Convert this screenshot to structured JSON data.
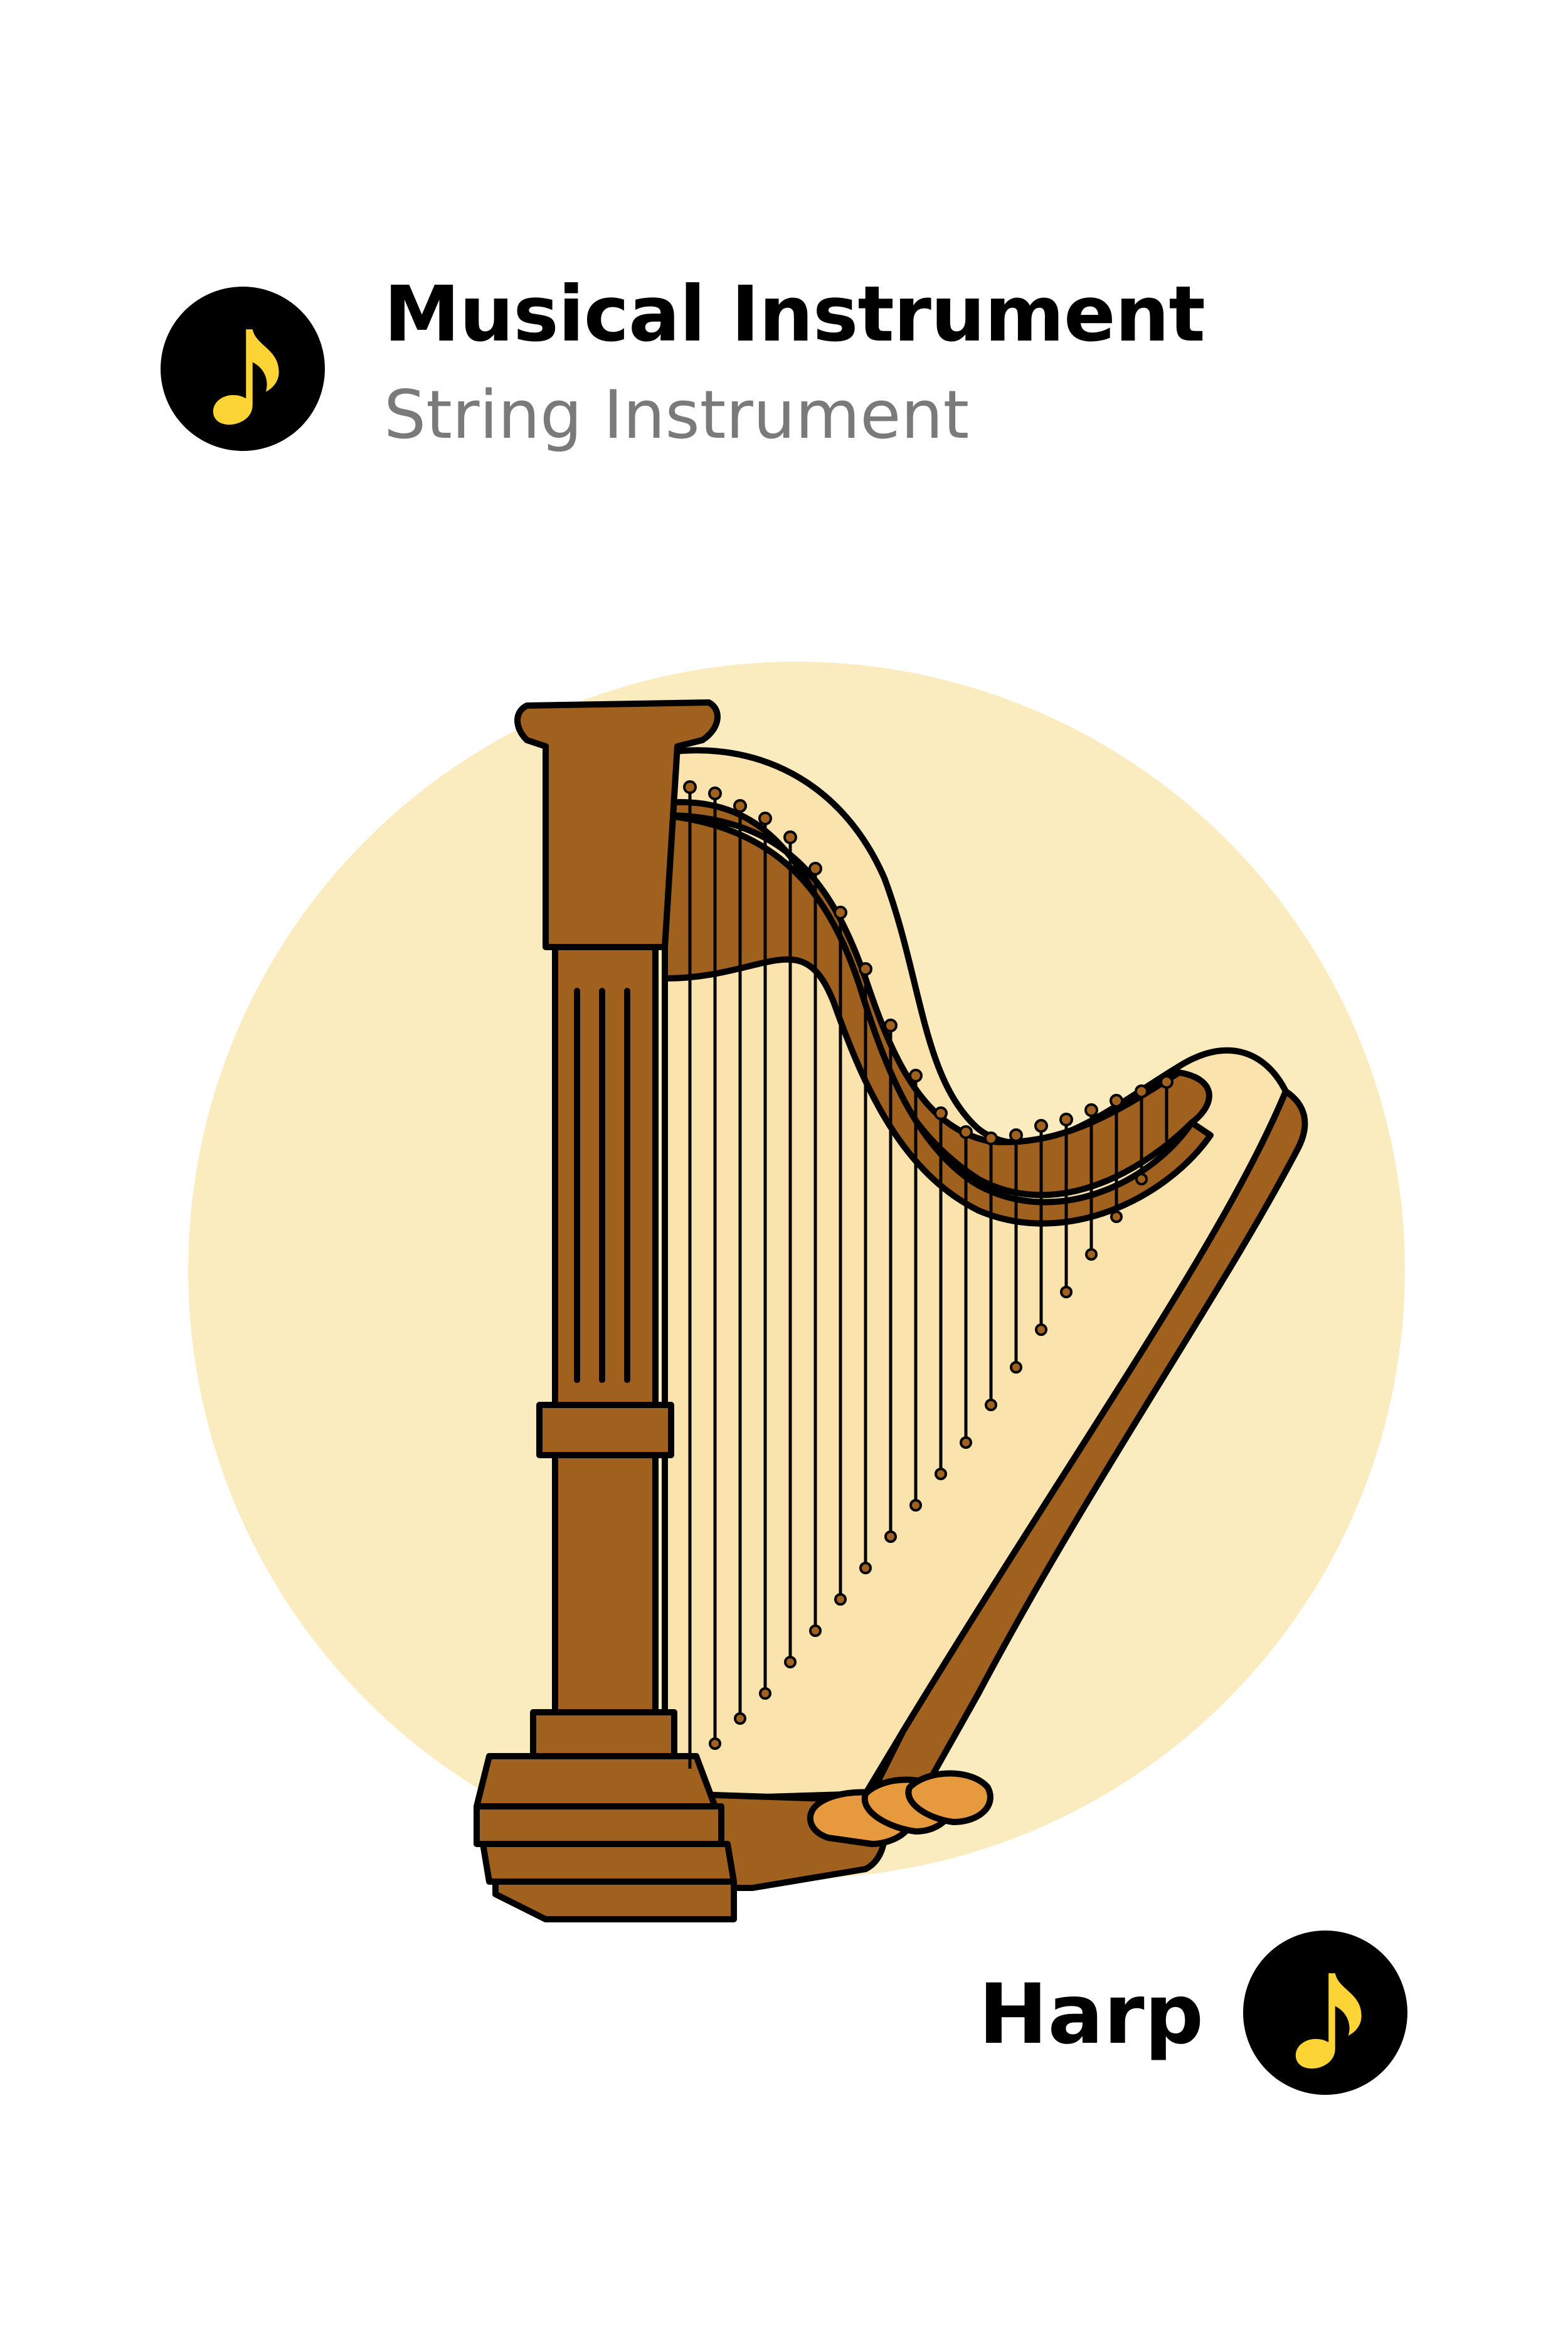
{
  "header": {
    "title": "Musical Instrument",
    "subtitle": "String Instrument",
    "icon": "music-note-icon"
  },
  "card": {
    "name": "Harp",
    "icon": "music-note-icon",
    "illustration": "harp-illustration"
  },
  "colors": {
    "badge_background": "#000000",
    "note_color": "#fdd435",
    "backdrop": "#fbecbf",
    "wood": "#a0611f",
    "soundboard": "#fae3ad",
    "pedal": "#e69a3d",
    "subtitle_text": "#7a7a7a"
  }
}
